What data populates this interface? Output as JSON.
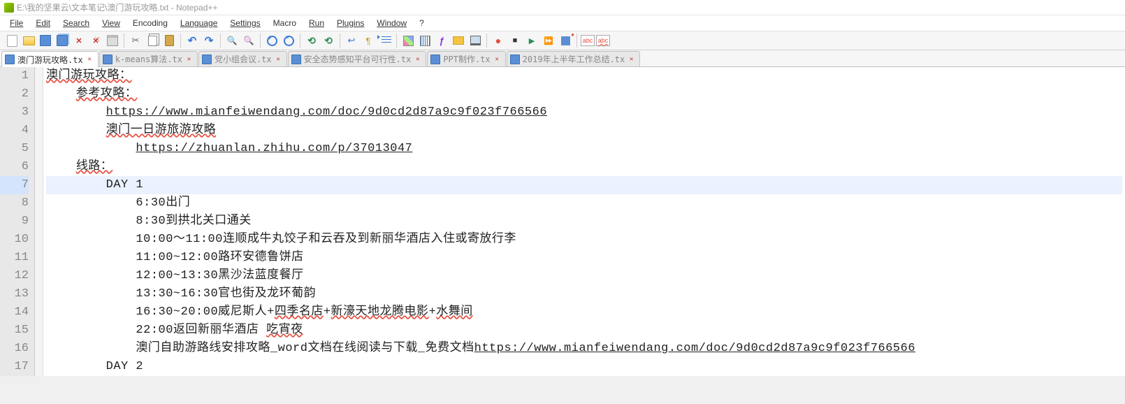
{
  "title": "E:\\我的坚果云\\文本笔记\\澳门游玩攻略.txt - Notepad++",
  "menu": {
    "file": "File",
    "edit": "Edit",
    "search": "Search",
    "view": "View",
    "encoding": "Encoding",
    "language": "Language",
    "settings": "Settings",
    "macro": "Macro",
    "run": "Run",
    "plugins": "Plugins",
    "window": "Window",
    "help": "?"
  },
  "tabs": [
    {
      "label": "澳门游玩攻略.tx",
      "active": true
    },
    {
      "label": "k-means算法.tx",
      "active": false
    },
    {
      "label": "党小组会议.tx",
      "active": false
    },
    {
      "label": "安全态势感知平台可行性.tx",
      "active": false
    },
    {
      "label": "PPT制作.tx",
      "active": false
    },
    {
      "label": "2019年上半年工作总结.tx",
      "active": false
    }
  ],
  "editor": {
    "current_line": 7,
    "lines": [
      {
        "n": 1,
        "indent": 0,
        "text": "澳门游玩攻略：",
        "spell": true
      },
      {
        "n": 2,
        "indent": 1,
        "text": "参考攻略：",
        "spell": true
      },
      {
        "n": 3,
        "indent": 2,
        "text": "",
        "link": "https://www.mianfeiwendang.com/doc/9d0cd2d87a9c9f023f766566"
      },
      {
        "n": 4,
        "indent": 2,
        "text": "澳门一日游旅游攻略",
        "spell": true
      },
      {
        "n": 5,
        "indent": 3,
        "text": "",
        "link": "https://zhuanlan.zhihu.com/p/37013047"
      },
      {
        "n": 6,
        "indent": 1,
        "text": "线路：",
        "spell": true
      },
      {
        "n": 7,
        "indent": 2,
        "text": "DAY 1"
      },
      {
        "n": 8,
        "indent": 3,
        "text": "6:30出门"
      },
      {
        "n": 9,
        "indent": 3,
        "text": "8:30到拱北关口通关"
      },
      {
        "n": 10,
        "indent": 3,
        "text": "10:00～11:00连顺成牛丸饺子和云吞及到新丽华酒店入住或寄放行李"
      },
      {
        "n": 11,
        "indent": 3,
        "text": "11:00~12:00路环安德鲁饼店"
      },
      {
        "n": 12,
        "indent": 3,
        "text": "12:00~13:30黑沙法蓝度餐厅"
      },
      {
        "n": 13,
        "indent": 3,
        "text": "13:30~16:30官也街及龙环葡韵"
      },
      {
        "n": 14,
        "indent": 3,
        "parts": [
          {
            "text": "16:30~20:00威尼斯人+"
          },
          {
            "text": "四季名店",
            "spell": true
          },
          {
            "text": "+"
          },
          {
            "text": "新濠天地龙腾电影",
            "spell": true
          },
          {
            "text": "+"
          },
          {
            "text": "水舞间",
            "spell": true
          }
        ]
      },
      {
        "n": 15,
        "indent": 3,
        "parts": [
          {
            "text": "22:00返回新丽华酒店 "
          },
          {
            "text": "吃宵夜",
            "spell": true
          }
        ]
      },
      {
        "n": 16,
        "indent": 3,
        "parts": [
          {
            "text": "澳门自助游路线安排攻略_word文档在线阅读与下载_免费文档"
          },
          {
            "link": "https://www.mianfeiwendang.com/doc/9d0cd2d87a9c9f023f766566"
          }
        ]
      },
      {
        "n": 17,
        "indent": 2,
        "text": "DAY 2"
      }
    ]
  }
}
